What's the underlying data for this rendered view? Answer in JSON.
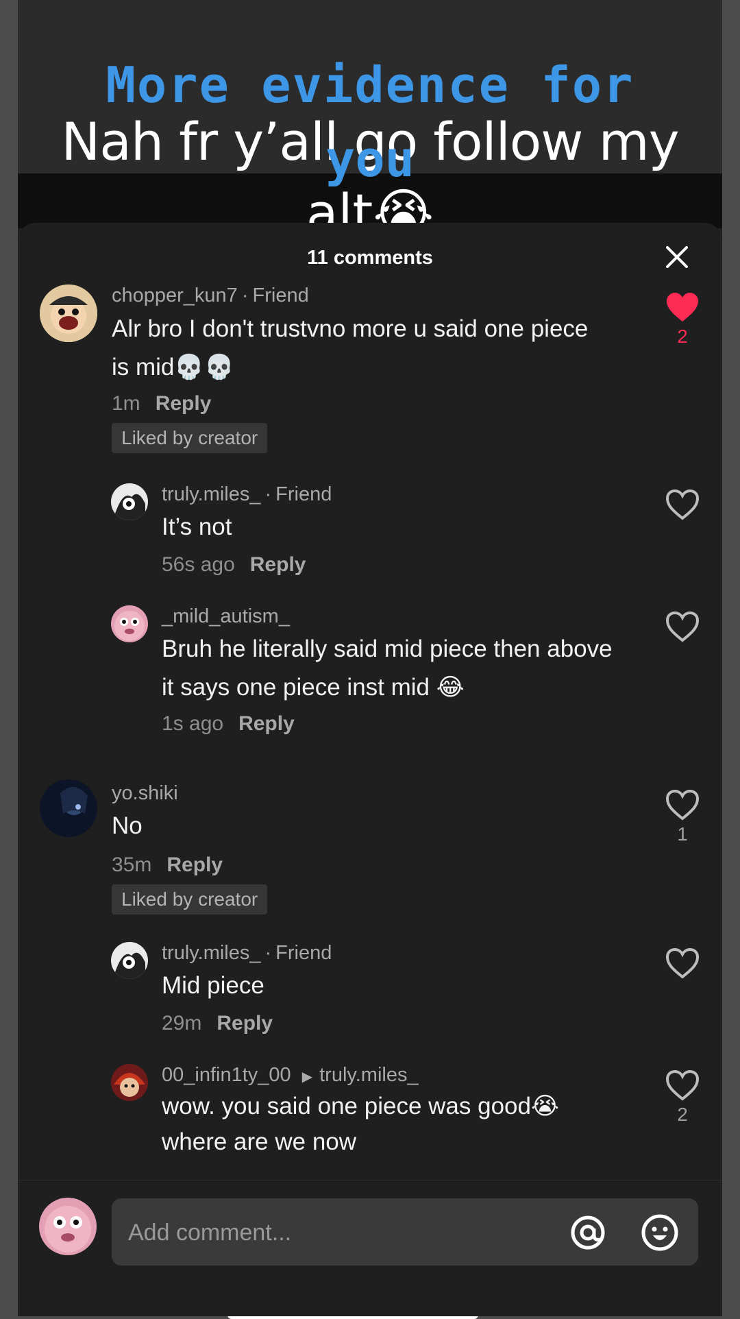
{
  "video": {
    "caption_blue": "More evidence for",
    "caption_white": "Nah fr y’all go follow my",
    "caption_white_2": "alt😭",
    "caption_you": "you"
  },
  "sheet": {
    "count_label": "11 comments",
    "close_icon": "close-icon"
  },
  "comments": [
    {
      "username": "chopper_kun7",
      "tag": "Friend",
      "text": "Alr bro I don't trustvno more u said one piece is mid💀💀",
      "time": "1m",
      "reply_label": "Reply",
      "badge": "Liked by creator",
      "likes": "2",
      "liked": true
    },
    {
      "username": "truly.miles_",
      "tag": "Friend",
      "text": "It’s not",
      "time": "56s ago",
      "reply_label": "Reply",
      "likes": ""
    },
    {
      "username": "_mild_autism_",
      "text": "Bruh he literally said mid piece then above it says one piece inst mid 😂",
      "time": "1s ago",
      "reply_label": "Reply",
      "likes": ""
    },
    {
      "username": "yo.shiki",
      "text": "No",
      "time": "35m",
      "reply_label": "Reply",
      "badge": "Liked by creator",
      "likes": "1"
    },
    {
      "username": "truly.miles_",
      "tag": "Friend",
      "text": "Mid piece",
      "time": "29m",
      "reply_label": "Reply",
      "likes": ""
    },
    {
      "username": "00_infin1ty_00",
      "reply_to": "truly.miles_",
      "text": "wow. you said one piece was good😭 where are we now",
      "likes": "2"
    }
  ],
  "input": {
    "placeholder": "Add comment...",
    "mention_icon": "at-icon",
    "emoji_icon": "emoji-icon"
  },
  "colors": {
    "accent_like": "#fe2c55",
    "caption_blue": "#3e96e6",
    "sheet_bg": "#1f1f1f"
  }
}
